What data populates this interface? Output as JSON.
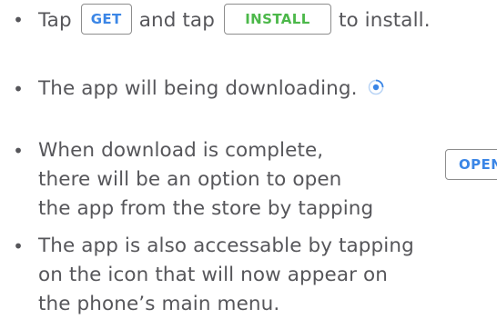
{
  "instructions": {
    "bullet_symbol": "•",
    "step1": {
      "text_before": "Tap",
      "get_button_label": "GET",
      "text_middle": "and tap",
      "install_button_label": "INSTALL",
      "text_after": "to install."
    },
    "step2": {
      "text": "The app will being downloading.",
      "icon": "download-progress-icon"
    },
    "step3": {
      "line1": "When download is complete,",
      "line2": "there will be an option to open",
      "line3": "the app from the store by tapping",
      "open_button_label": "OPEN"
    },
    "step4": {
      "line1": "The app is also accessable by tapping",
      "line2": "on the icon that will now appear on",
      "line3": "the phone’s main menu."
    }
  },
  "colors": {
    "text": "#56565a",
    "get_button_text": "#3b86e6",
    "install_button_text": "#4cb84a",
    "open_button_text": "#3b86e6",
    "button_border": "#8d8d8d",
    "progress_icon": "#3b86e6"
  }
}
